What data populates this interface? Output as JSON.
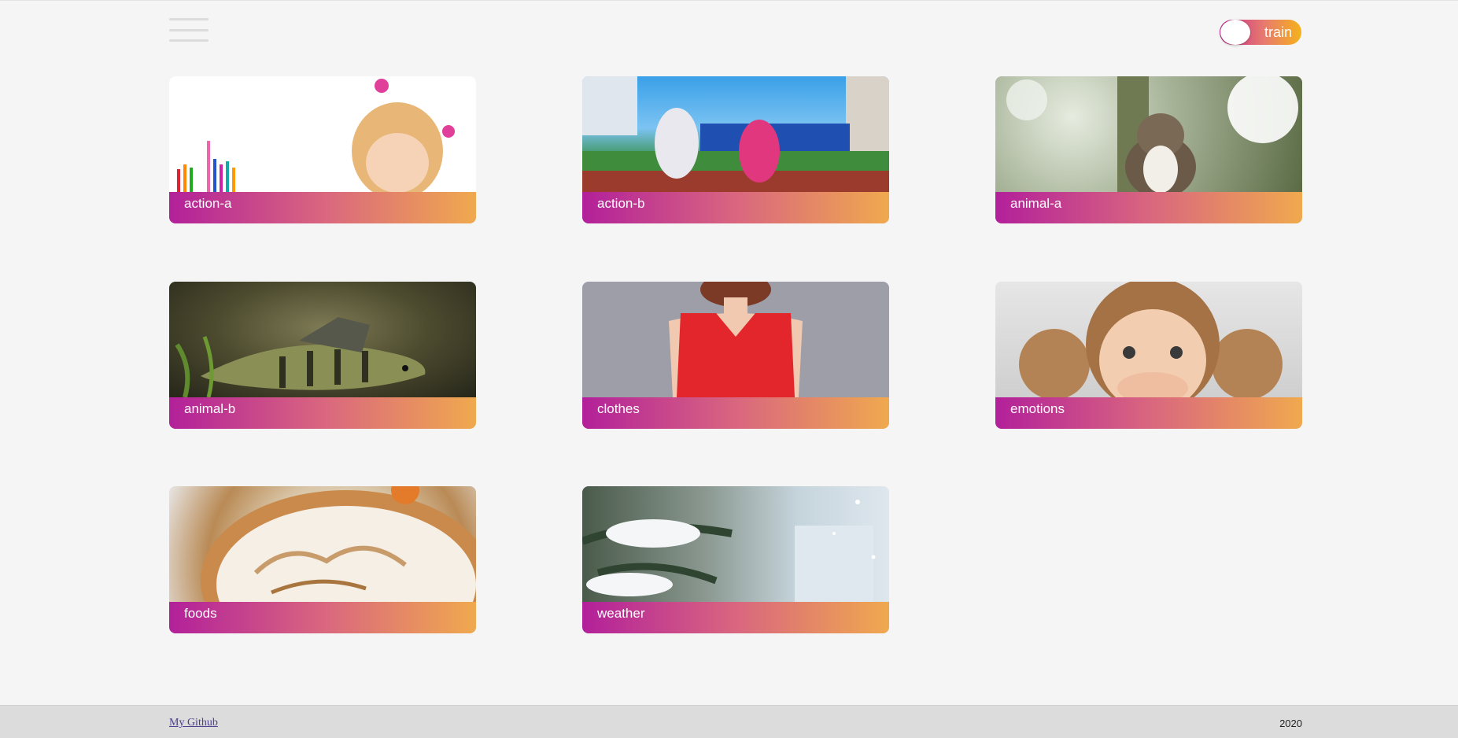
{
  "header": {
    "menu_icon": "hamburger-icon",
    "toggle_label": "train"
  },
  "cards": [
    {
      "caption": "action-a",
      "image_desc_icon": "girl-with-pencils-image"
    },
    {
      "caption": "action-b",
      "image_desc_icon": "girls-running-track-image"
    },
    {
      "caption": "animal-a",
      "image_desc_icon": "cat-image"
    },
    {
      "caption": "animal-b",
      "image_desc_icon": "fish-image"
    },
    {
      "caption": "clothes",
      "image_desc_icon": "red-dress-image"
    },
    {
      "caption": "emotions",
      "image_desc_icon": "surprised-girl-image"
    },
    {
      "caption": "foods",
      "image_desc_icon": "meringue-pie-image"
    },
    {
      "caption": "weather",
      "image_desc_icon": "snowy-tree-image"
    }
  ],
  "footer": {
    "link_label": "My Github",
    "year": "2020"
  },
  "colors": {
    "gradient_start": "#b2209a",
    "gradient_mid": "#d9667f",
    "gradient_end": "#f0a94e",
    "background": "#f5f5f5",
    "footer_bg": "#dcdcdc"
  }
}
